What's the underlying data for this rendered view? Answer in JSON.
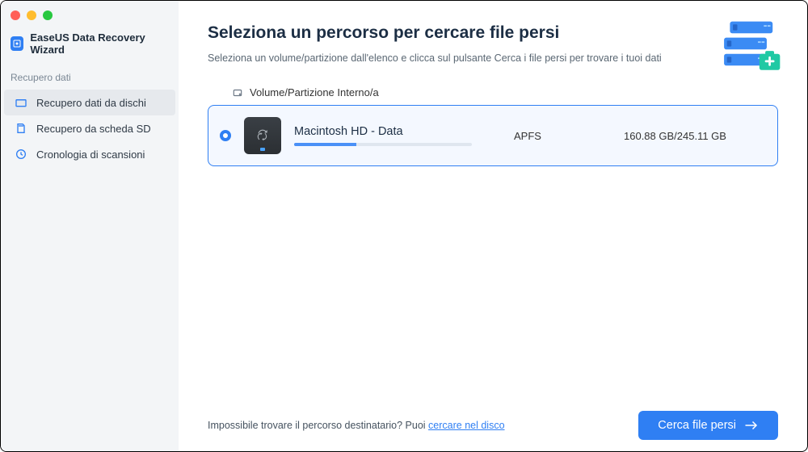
{
  "app": {
    "title": "EaseUS Data Recovery Wizard"
  },
  "sidebar": {
    "section_label": "Recupero dati",
    "items": [
      {
        "label": "Recupero dati da dischi"
      },
      {
        "label": "Recupero da scheda SD"
      },
      {
        "label": "Cronologia di scansioni"
      }
    ]
  },
  "main": {
    "heading": "Seleziona un percorso per cercare file persi",
    "subheading": "Seleziona un volume/partizione dall'elenco e clicca sul pulsante Cerca i file persi per trovare i tuoi dati",
    "group_label": "Volume/Partizione Interno/a",
    "volume": {
      "name": "Macintosh HD - Data",
      "filesystem": "APFS",
      "size_text": "160.88 GB/245.11 GB",
      "used_pct": 35
    }
  },
  "footer": {
    "prefix": "Impossibile trovare il percorso destinatario? Puoi ",
    "link": "cercare nel disco",
    "cta": "Cerca file persi"
  }
}
